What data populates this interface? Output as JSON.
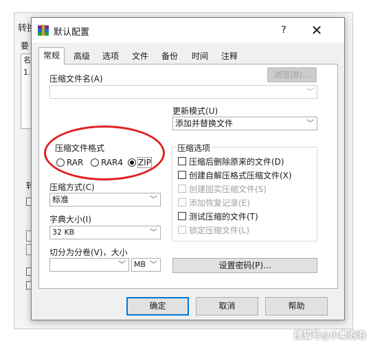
{
  "background_window": {
    "title": "转换",
    "close": "✕",
    "label": "要",
    "list_col": "名",
    "list_item": "1.",
    "convert_label": "转"
  },
  "dialog": {
    "title": "默认配置",
    "help": "?",
    "close": "✕",
    "tabs": [
      "常规",
      "高级",
      "选项",
      "文件",
      "备份",
      "时间",
      "注释"
    ],
    "active_tab": "常规",
    "archive_name_label": "压缩文件名(A)",
    "archive_name_value": "",
    "browse_button": "浏览(B)...",
    "update_mode_label": "更新模式(U)",
    "update_mode_value": "添加并替换文件",
    "format_group_label": "压缩文件格式",
    "formats": [
      {
        "label": "RAR",
        "selected": false
      },
      {
        "label": "RAR4",
        "selected": false
      },
      {
        "label": "ZIP",
        "selected": true
      }
    ],
    "method_label": "压缩方式(C)",
    "method_value": "标准",
    "dict_label": "字典大小(I)",
    "dict_value": "32 KB",
    "split_label": "切分为分卷(V)，大小",
    "split_value": "",
    "split_unit": "MB",
    "options_group_label": "压缩选项",
    "options": [
      {
        "label": "压缩后删除原来的文件(D)",
        "checked": false,
        "enabled": true
      },
      {
        "label": "创建自解压格式压缩文件(X)",
        "checked": false,
        "enabled": true
      },
      {
        "label": "创建固实压缩文件(S)",
        "checked": false,
        "enabled": false
      },
      {
        "label": "添加恢复记录(E)",
        "checked": false,
        "enabled": false
      },
      {
        "label": "测试压缩的文件(T)",
        "checked": false,
        "enabled": true
      },
      {
        "label": "锁定压缩文件(L)",
        "checked": false,
        "enabled": false
      }
    ],
    "password_button": "设置密码(P)...",
    "ok_button": "确定",
    "cancel_button": "取消",
    "help_button": "帮助"
  },
  "watermark": "搜狐号@小奥泡泡",
  "colors": {
    "highlight": "#e02020",
    "focus": "#0078d7"
  }
}
